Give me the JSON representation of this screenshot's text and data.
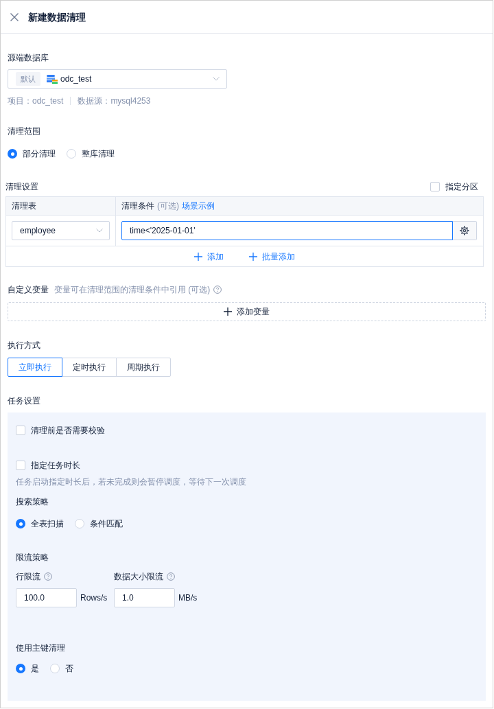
{
  "header": {
    "title": "新建数据清理"
  },
  "source_database": {
    "label": "源端数据库",
    "tag": "默认",
    "value": "odc_test",
    "project": "项目：odc_test",
    "datasource": "数据源：mysql4253"
  },
  "cleanup_scope": {
    "label": "清理范围",
    "options": [
      {
        "label": "部分清理",
        "selected": true
      },
      {
        "label": "整库清理",
        "selected": false
      }
    ]
  },
  "cleanup_settings": {
    "label": "清理设置",
    "partition": {
      "label": "指定分区",
      "checked": false
    },
    "columns": [
      {
        "label": "清理表"
      },
      {
        "label": "清理条件",
        "hint": "(可选)",
        "link": "场景示例"
      }
    ],
    "rows": [
      {
        "table": "employee",
        "condition": "time<'2025-01-01'"
      }
    ],
    "actions": [
      "添加",
      "批量添加"
    ]
  },
  "custom_variables": {
    "label": "自定义变量",
    "hint": "变量可在清理范围的清理条件中引用 (可选)",
    "add_button": "添加变量"
  },
  "execution_mode": {
    "label": "执行方式",
    "options": [
      {
        "label": "立即执行",
        "selected": true
      },
      {
        "label": "定时执行",
        "selected": false
      },
      {
        "label": "周期执行",
        "selected": false
      }
    ]
  },
  "task_settings": {
    "label": "任务设置",
    "checkboxes": [
      {
        "label": "清理前是否需要校验",
        "checked": false
      },
      {
        "label": "指定任务时长",
        "checked": false,
        "hint": "任务启动指定时长后，若未完成则会暂停调度，等待下一次调度"
      }
    ],
    "search_strategy": {
      "label": "搜索策略",
      "options": [
        {
          "label": "全表扫描",
          "selected": true
        },
        {
          "label": "条件匹配",
          "selected": false
        }
      ]
    },
    "rate_limit": {
      "label": "限流策略",
      "fields": [
        {
          "label": "行限流",
          "value": "100.0",
          "unit": "Rows/s"
        },
        {
          "label": "数据大小限流",
          "value": "1.0",
          "unit": "MB/s"
        }
      ]
    },
    "primary_key": {
      "label": "使用主键清理",
      "options": [
        {
          "label": "是",
          "selected": true
        },
        {
          "label": "否",
          "selected": false
        }
      ]
    }
  }
}
